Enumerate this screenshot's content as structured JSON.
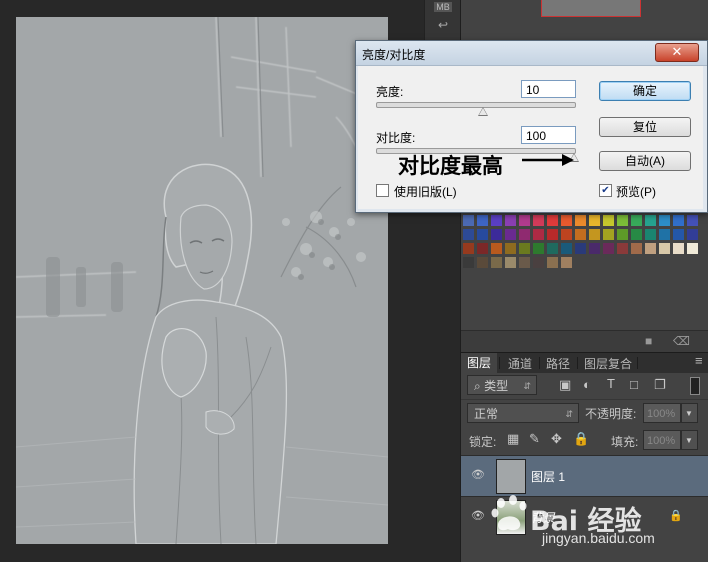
{
  "dialog": {
    "title": "亮度/对比度",
    "close": "✕",
    "brightness_label": "亮度:",
    "brightness_value": "10",
    "brightness_level": 0.54,
    "contrast_label": "对比度:",
    "contrast_value": "100",
    "contrast_level": 1.0,
    "legacy_label": "使用旧版(L)",
    "legacy_checked": false,
    "ok_label": "确定",
    "reset_label": "复位",
    "auto_label": "自动(A)",
    "preview_label": "预览(P)",
    "preview_checked": true
  },
  "annotation": {
    "text": "对比度最高"
  },
  "layers_panel": {
    "tabs": [
      "图层",
      "通道",
      "路径",
      "图层复合"
    ],
    "filter_kind": "类型",
    "blend_mode": "正常",
    "opacity_label": "不透明度:",
    "opacity_value": "100%",
    "lock_label": "锁定:",
    "fill_label": "填充:",
    "fill_value": "100%",
    "layers": [
      {
        "name": "图层 1",
        "selected": true,
        "locked": false
      },
      {
        "name": "背景",
        "selected": false,
        "locked": true
      }
    ]
  },
  "toolstrip": {
    "top_label": "MB"
  },
  "watermark": {
    "logo": "Bai 经验",
    "url": "jingyan.baidu.com"
  },
  "colors": {
    "dialog_title_bg": "#c5d3e2",
    "close_button": "#c8432b",
    "dock_bg": "#434343",
    "selected_layer": "#5b6b7d",
    "canvas": "#a2a6a8"
  },
  "swatch_colors": [
    "#4c6ab3",
    "#3e65c5",
    "#5a3fc4",
    "#8b3fb3",
    "#b13b8e",
    "#d23b5a",
    "#e13b3b",
    "#e85a2e",
    "#eb8a2c",
    "#e9b62c",
    "#c5c72d",
    "#7cbd38",
    "#38a95a",
    "#26a38f",
    "#2d8ec8",
    "#316fcb",
    "#4451b8",
    "#2d4a96",
    "#274a9e",
    "#3c2a9a",
    "#6a2a90",
    "#8f2a70",
    "#ad2a44",
    "#b82a2a",
    "#bd4420",
    "#c36d1f",
    "#c4961f",
    "#a3a320",
    "#5e9a28",
    "#278a45",
    "#1a8570",
    "#1f72a6",
    "#2457a8",
    "#323d96",
    "#963a1e",
    "#7b2828",
    "#b85a1e",
    "#8e6b1f",
    "#6a7a1f",
    "#2e7a2e",
    "#1f6a5e",
    "#1a5a7a",
    "#2a3a7a",
    "#4a2a6a",
    "#6a2a5a",
    "#8a3a3a",
    "#a06a4a",
    "#c0a080",
    "#d8c8a8",
    "#e8dcc8",
    "#f0ead8",
    "#3a3a3a",
    "#5a4a3a",
    "#7a6a4a",
    "#9a8a6a",
    "#6a5a4a",
    "#4a4040",
    "#8a7050",
    "#a08060"
  ]
}
